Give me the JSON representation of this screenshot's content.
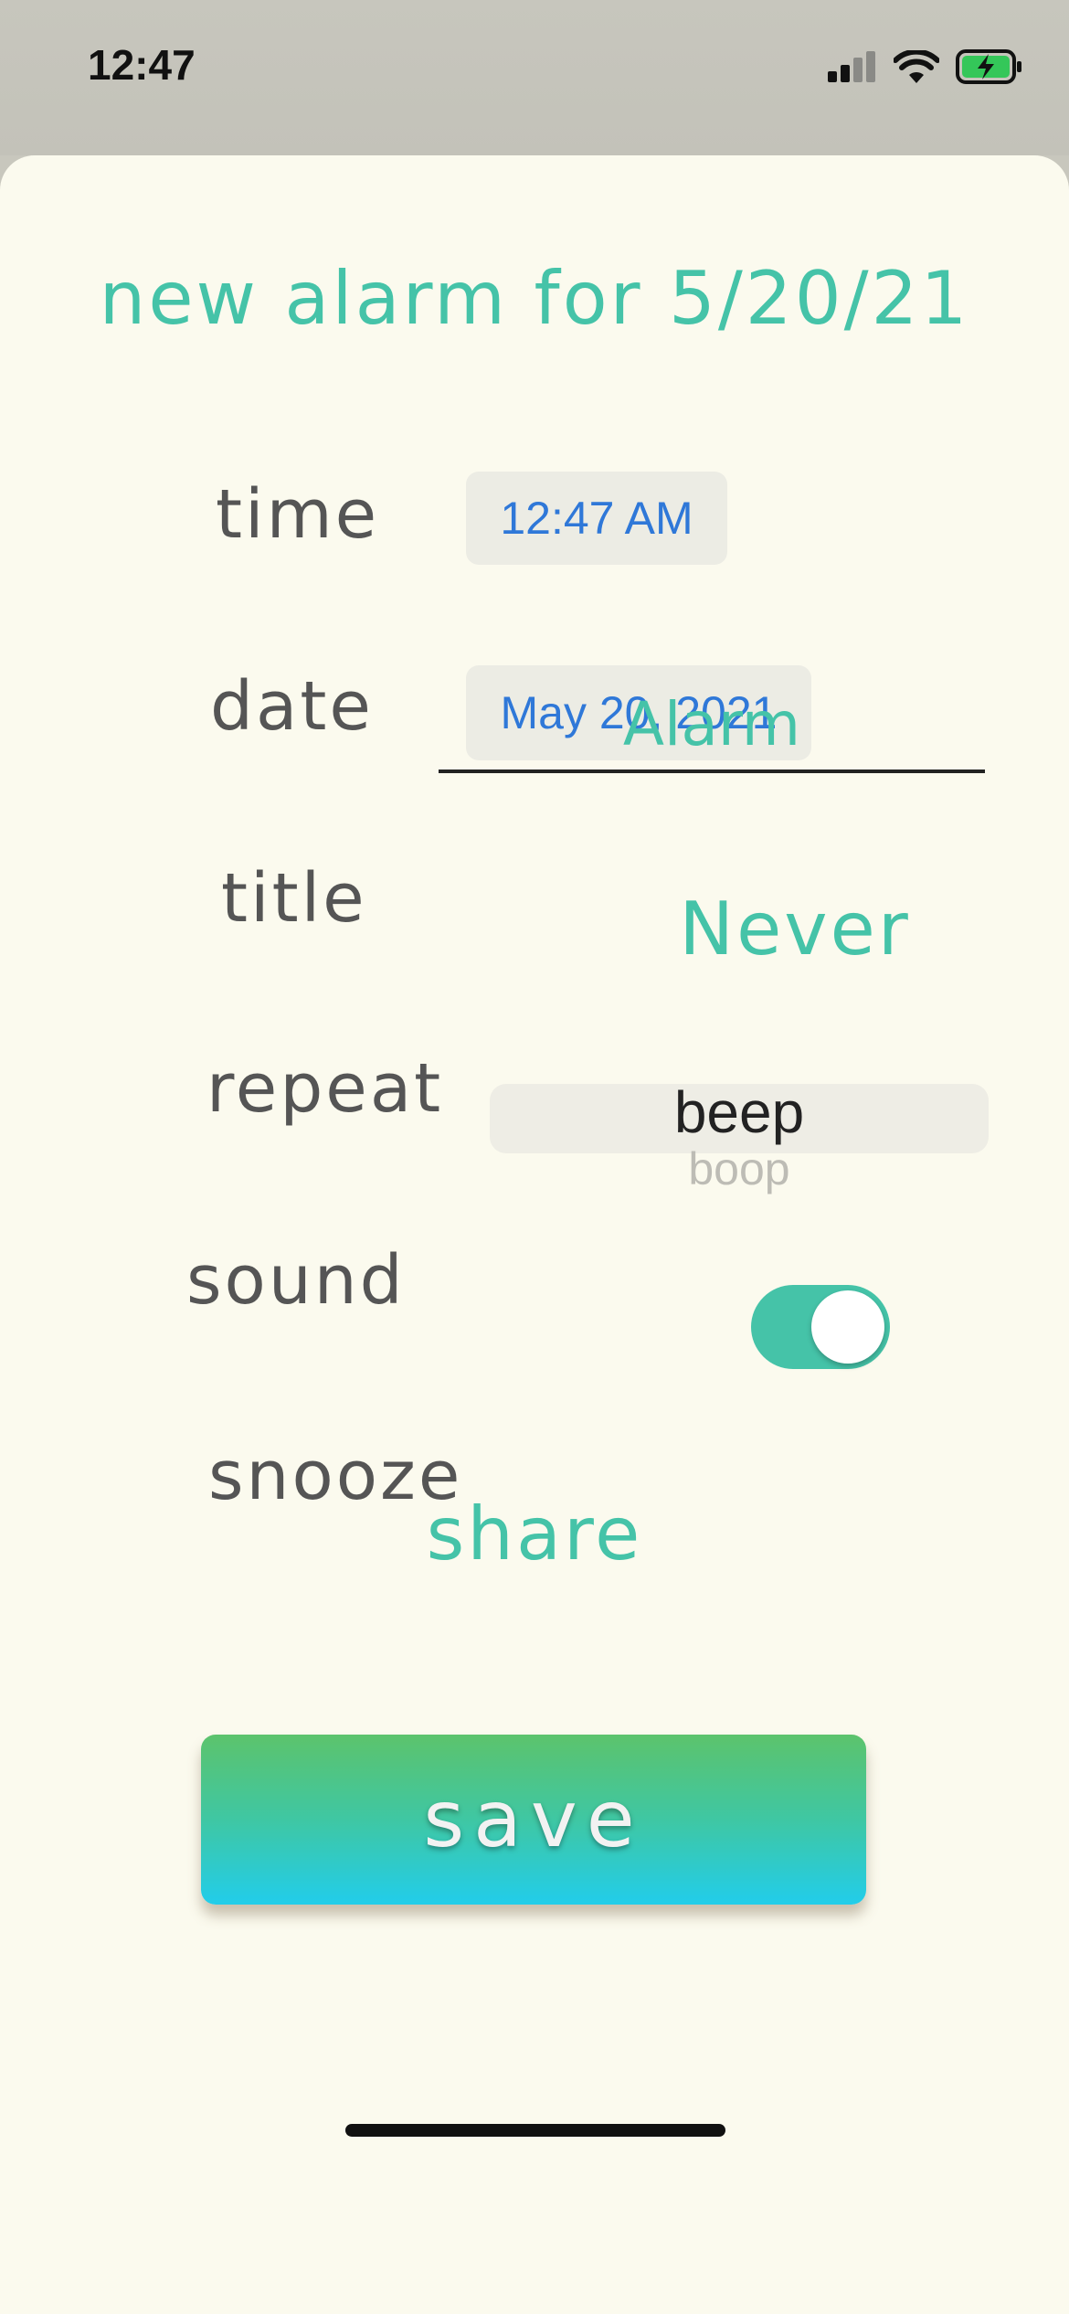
{
  "status_bar": {
    "time": "12:47",
    "icons": [
      "cellular-signal-icon",
      "wifi-icon",
      "battery-charging-icon"
    ]
  },
  "sheet": {
    "title": "new alarm for 5/20/21"
  },
  "form": {
    "time": {
      "label": "time",
      "value": "12:47 AM"
    },
    "date": {
      "label": "date",
      "value": "May 20, 2021"
    },
    "title": {
      "label": "title",
      "value": "Alarm"
    },
    "repeat": {
      "label": "repeat",
      "value": "Never"
    },
    "sound": {
      "label": "sound",
      "selected": "beep",
      "next": "boop"
    },
    "snooze": {
      "label": "snooze",
      "on": true
    },
    "share_label": "share"
  },
  "save_label": "save",
  "colors": {
    "accent": "#45c3a8",
    "label": "#555555",
    "sheet_bg": "#fbfaee",
    "link_blue": "#2f78d8"
  }
}
